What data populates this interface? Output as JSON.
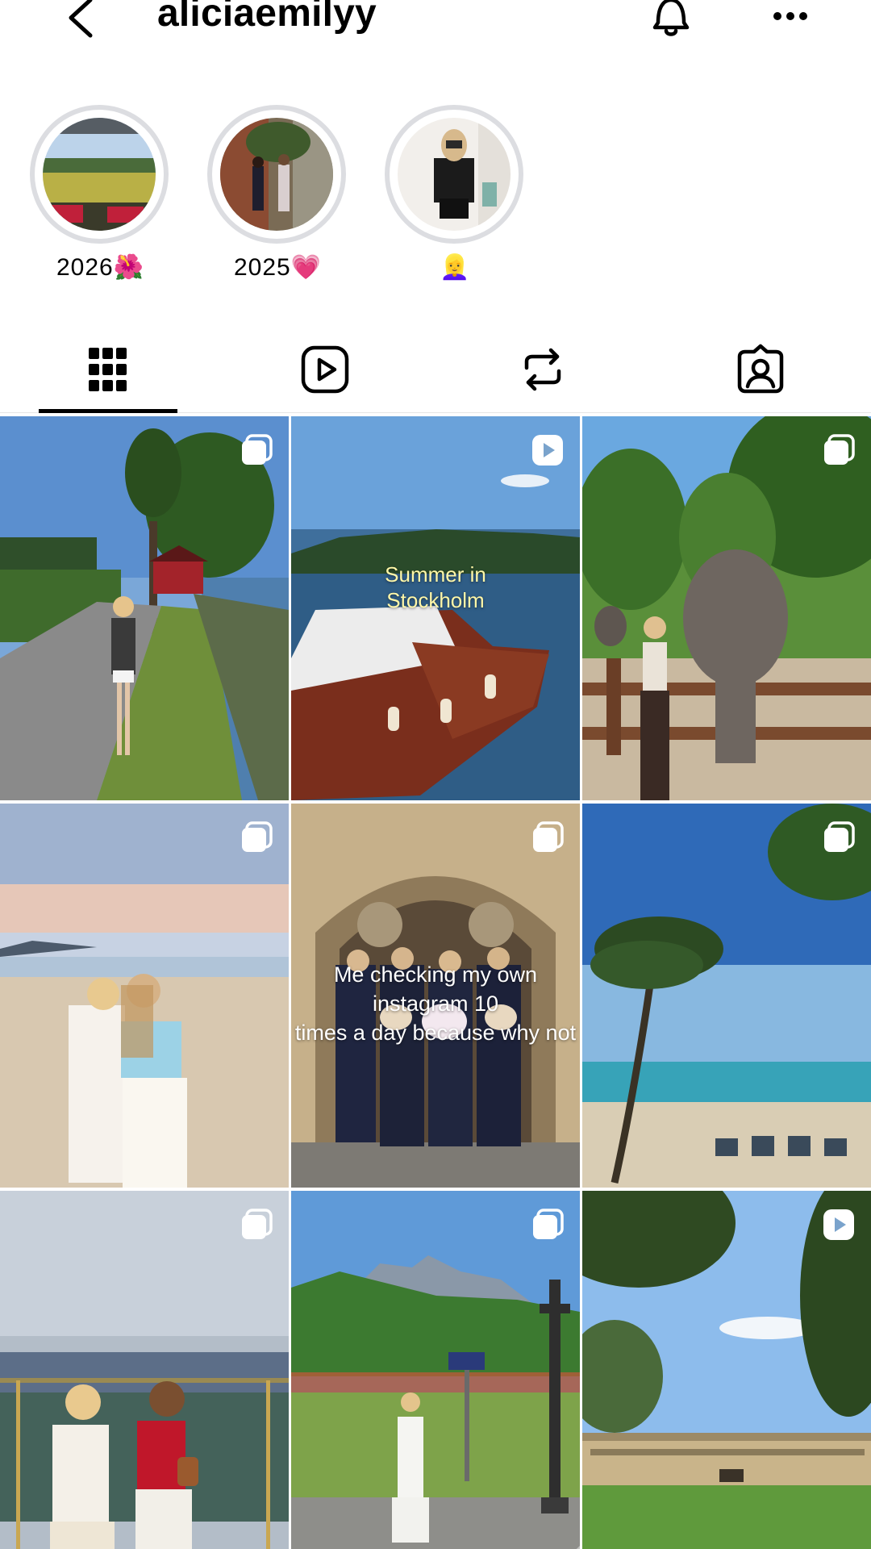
{
  "header": {
    "username": "aliciaemilyy",
    "back_icon": "chevron-left-icon",
    "bell_icon": "bell-icon",
    "more_icon": "more-horizontal-icon"
  },
  "highlights": [
    {
      "label": "2026🌺"
    },
    {
      "label": "2025💗"
    },
    {
      "label": "👱‍♀️"
    }
  ],
  "tabs": [
    {
      "name": "posts",
      "icon": "grid-icon",
      "active": true
    },
    {
      "name": "reels",
      "icon": "reels-icon",
      "active": false
    },
    {
      "name": "reposts",
      "icon": "repost-icon",
      "active": false
    },
    {
      "name": "tagged",
      "icon": "tagged-icon",
      "active": false
    }
  ],
  "posts": [
    {
      "type": "carousel",
      "overlay_text": ""
    },
    {
      "type": "video",
      "overlay_text": "Summer in\nStockholm"
    },
    {
      "type": "carousel",
      "overlay_text": ""
    },
    {
      "type": "carousel",
      "overlay_text": ""
    },
    {
      "type": "carousel",
      "overlay_text": "Me checking my own instagram 10\ntimes a day because why not"
    },
    {
      "type": "carousel",
      "overlay_text": ""
    },
    {
      "type": "carousel",
      "overlay_text": ""
    },
    {
      "type": "carousel",
      "overlay_text": ""
    },
    {
      "type": "video",
      "overlay_text": ""
    }
  ],
  "colors": {
    "accent": "#000000",
    "ring": "#dcdde1",
    "overlay_yellow": "#fff7a8"
  }
}
